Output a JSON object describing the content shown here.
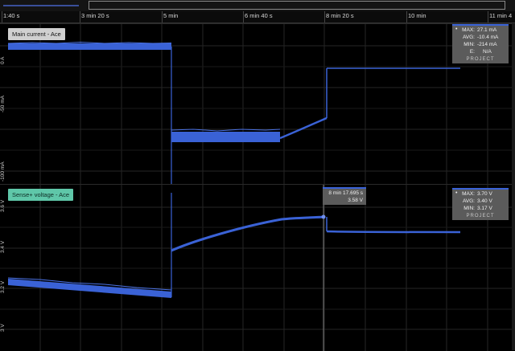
{
  "time_axis": {
    "ticks": [
      "1:40 s",
      "3 min 20 s",
      "5 min",
      "6 min 40 s",
      "8 min 20 s",
      "10 min",
      "11 min 4"
    ]
  },
  "current_pane": {
    "title": "Main current - Ace",
    "y_ticks": [
      "0 A",
      "-50 mA",
      "-100 mA"
    ],
    "stats": {
      "max_label": "MAX:",
      "max_value": "27.1 mA",
      "avg_label": "AVG:",
      "avg_value": "-10.4 mA",
      "min_label": "MIN:",
      "min_value": "-214 mA",
      "e_label": "E:",
      "e_value": "N/A",
      "project_label": "PROJECT"
    }
  },
  "voltage_pane": {
    "title": "Sense+ voltage - Ace",
    "y_ticks": [
      "3.6 V",
      "3.4 V",
      "3.2 V",
      "3 V"
    ],
    "stats": {
      "max_label": "MAX:",
      "max_value": "3.70 V",
      "avg_label": "AVG:",
      "avg_value": "3.40 V",
      "min_label": "MIN:",
      "min_value": "3.17 V",
      "project_label": "PROJECT"
    },
    "cursor": {
      "time": "8 min 17.695 s",
      "value": "3.58 V"
    }
  },
  "colors": {
    "trace": "#3a62d6",
    "current_title_bg": "#d0d0d0",
    "voltage_title_bg": "#5fc7a9"
  }
}
